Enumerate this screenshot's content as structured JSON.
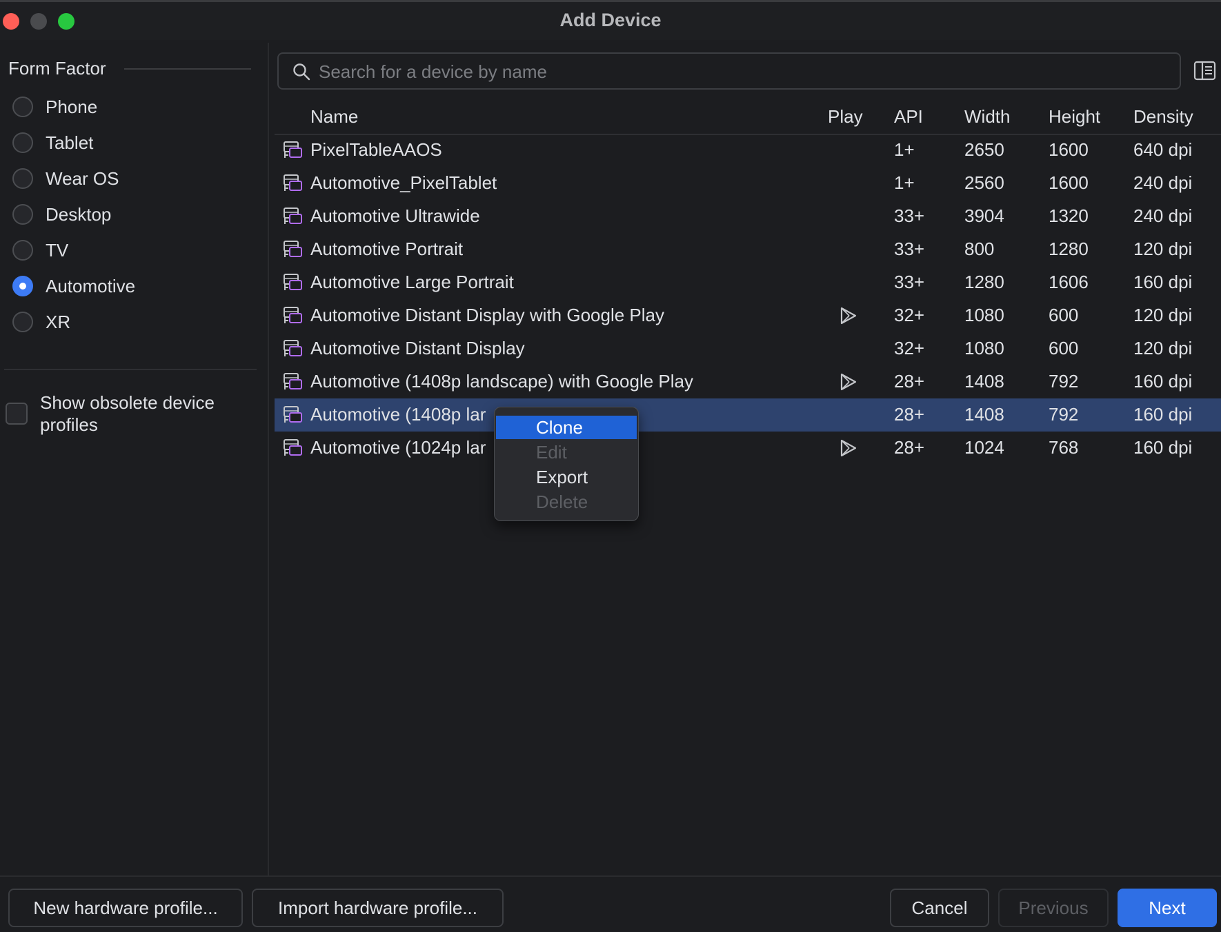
{
  "window": {
    "title": "Add Device"
  },
  "sidebar": {
    "heading": "Form Factor",
    "options": [
      {
        "label": "Phone",
        "selected": false
      },
      {
        "label": "Tablet",
        "selected": false
      },
      {
        "label": "Wear OS",
        "selected": false
      },
      {
        "label": "Desktop",
        "selected": false
      },
      {
        "label": "TV",
        "selected": false
      },
      {
        "label": "Automotive",
        "selected": true
      },
      {
        "label": "XR",
        "selected": false
      }
    ],
    "obsolete_label": "Show obsolete device profiles",
    "obsolete_checked": false
  },
  "search": {
    "placeholder": "Search for a device by name",
    "value": ""
  },
  "table": {
    "columns": [
      "Name",
      "Play",
      "API",
      "Width",
      "Height",
      "Density"
    ],
    "rows": [
      {
        "name": "PixelTableAAOS",
        "play": false,
        "api": "1+",
        "width": "2650",
        "height": "1600",
        "density": "640 dpi"
      },
      {
        "name": "Automotive_PixelTablet",
        "play": false,
        "api": "1+",
        "width": "2560",
        "height": "1600",
        "density": "240 dpi"
      },
      {
        "name": "Automotive Ultrawide",
        "play": false,
        "api": "33+",
        "width": "3904",
        "height": "1320",
        "density": "240 dpi"
      },
      {
        "name": "Automotive Portrait",
        "play": false,
        "api": "33+",
        "width": "800",
        "height": "1280",
        "density": "120 dpi"
      },
      {
        "name": "Automotive Large Portrait",
        "play": false,
        "api": "33+",
        "width": "1280",
        "height": "1606",
        "density": "160 dpi"
      },
      {
        "name": "Automotive Distant Display with Google Play",
        "play": true,
        "api": "32+",
        "width": "1080",
        "height": "600",
        "density": "120 dpi"
      },
      {
        "name": "Automotive Distant Display",
        "play": false,
        "api": "32+",
        "width": "1080",
        "height": "600",
        "density": "120 dpi"
      },
      {
        "name": "Automotive (1408p landscape) with Google Play",
        "play": true,
        "api": "28+",
        "width": "1408",
        "height": "792",
        "density": "160 dpi"
      },
      {
        "name": "Automotive (1408p lar",
        "play": false,
        "api": "28+",
        "width": "1408",
        "height": "792",
        "density": "160 dpi"
      },
      {
        "name": "Automotive (1024p lar",
        "play": true,
        "api": "28+",
        "width": "1024",
        "height": "768",
        "density": "160 dpi"
      }
    ],
    "selected_index": 8
  },
  "context_menu": {
    "items": [
      {
        "label": "Clone",
        "enabled": true,
        "active": true
      },
      {
        "label": "Edit",
        "enabled": false,
        "active": false
      },
      {
        "label": "Export",
        "enabled": true,
        "active": false
      },
      {
        "label": "Delete",
        "enabled": false,
        "active": false
      }
    ]
  },
  "footer": {
    "new_profile": "New hardware profile...",
    "import_profile": "Import hardware profile...",
    "cancel": "Cancel",
    "previous": "Previous",
    "next": "Next"
  },
  "colors": {
    "accent": "#2f6fe5",
    "selection": "#2e436e",
    "device_icon": "#b06cf0"
  },
  "icons": {
    "device": "car-display-icon",
    "play": "google-play-icon",
    "search": "search-icon",
    "layout": "details-panel-icon"
  }
}
